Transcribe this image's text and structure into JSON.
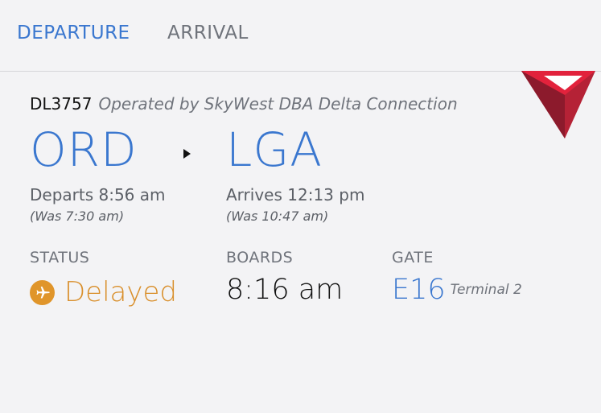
{
  "tabs": {
    "departure_label": "DEPARTURE",
    "arrival_label": "ARRIVAL",
    "active": "DEPARTURE"
  },
  "flight": {
    "number": "DL3757",
    "operated_by": "Operated by SkyWest DBA Delta Connection",
    "origin": "ORD",
    "destination": "LGA",
    "departs": "Departs 8:56 am",
    "departs_was": "(Was 7:30 am)",
    "arrives": "Arrives 12:13 pm",
    "arrives_was": "(Was 10:47 am)"
  },
  "details": {
    "status_label": "STATUS",
    "status_value": "Delayed",
    "status_icon": "plane-icon",
    "boards_label": "BOARDS",
    "boards_value": "8:16 am",
    "gate_label": "GATE",
    "gate_value": "E16",
    "terminal": "Terminal 2"
  },
  "colors": {
    "accent_blue": "#3a77cf",
    "delayed_orange": "#d98f2b",
    "logo_red": "#b52236"
  }
}
